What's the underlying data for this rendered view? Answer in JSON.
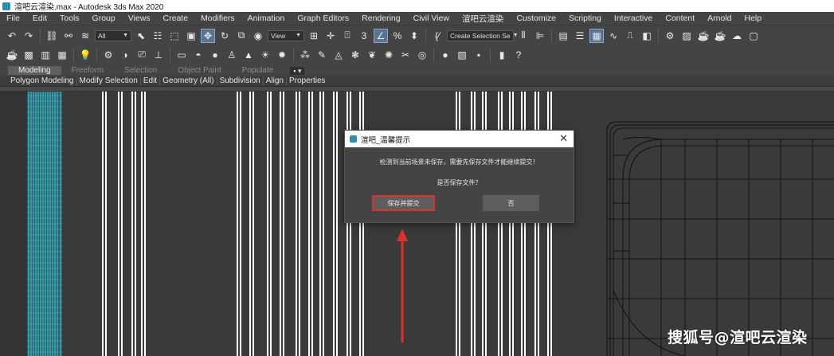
{
  "window": {
    "title": "渲吧云渲染.max - Autodesk 3ds Max 2020"
  },
  "menu": [
    "File",
    "Edit",
    "Tools",
    "Group",
    "Views",
    "Create",
    "Modifiers",
    "Animation",
    "Graph Editors",
    "Rendering",
    "Civil View",
    "渲吧云渲染",
    "Customize",
    "Scripting",
    "Interactive",
    "Content",
    "Arnold",
    "Help"
  ],
  "toolbar": {
    "filter_select": "All",
    "ref_coord_select": "View",
    "selection_set_select": "Create Selection Se"
  },
  "ribbon": {
    "tabs": [
      "Modeling",
      "Freeform",
      "Selection",
      "Object Paint",
      "Populate"
    ],
    "active_tab": "Modeling",
    "panels": [
      "Polygon Modeling",
      "Modify Selection",
      "Edit",
      "Geometry (All)",
      "Subdivision",
      "Align",
      "Properties"
    ]
  },
  "dialog": {
    "title": "渲吧_温馨提示",
    "message": "检测到当前场景未保存，需要先保存文件才能继续提交！",
    "question": "是否保存文件？",
    "save_button": "保存并提交",
    "no_button": "否",
    "highlight_color": "#e0302c"
  },
  "annotation": {
    "arrow_color": "#e0302c"
  },
  "watermark": "搜狐号@渲吧云渲染",
  "colors": {
    "viewport_bg": "#3a3a3a",
    "mesh_cyan": "#3fc6d6",
    "active_tool": "#5a7390"
  }
}
